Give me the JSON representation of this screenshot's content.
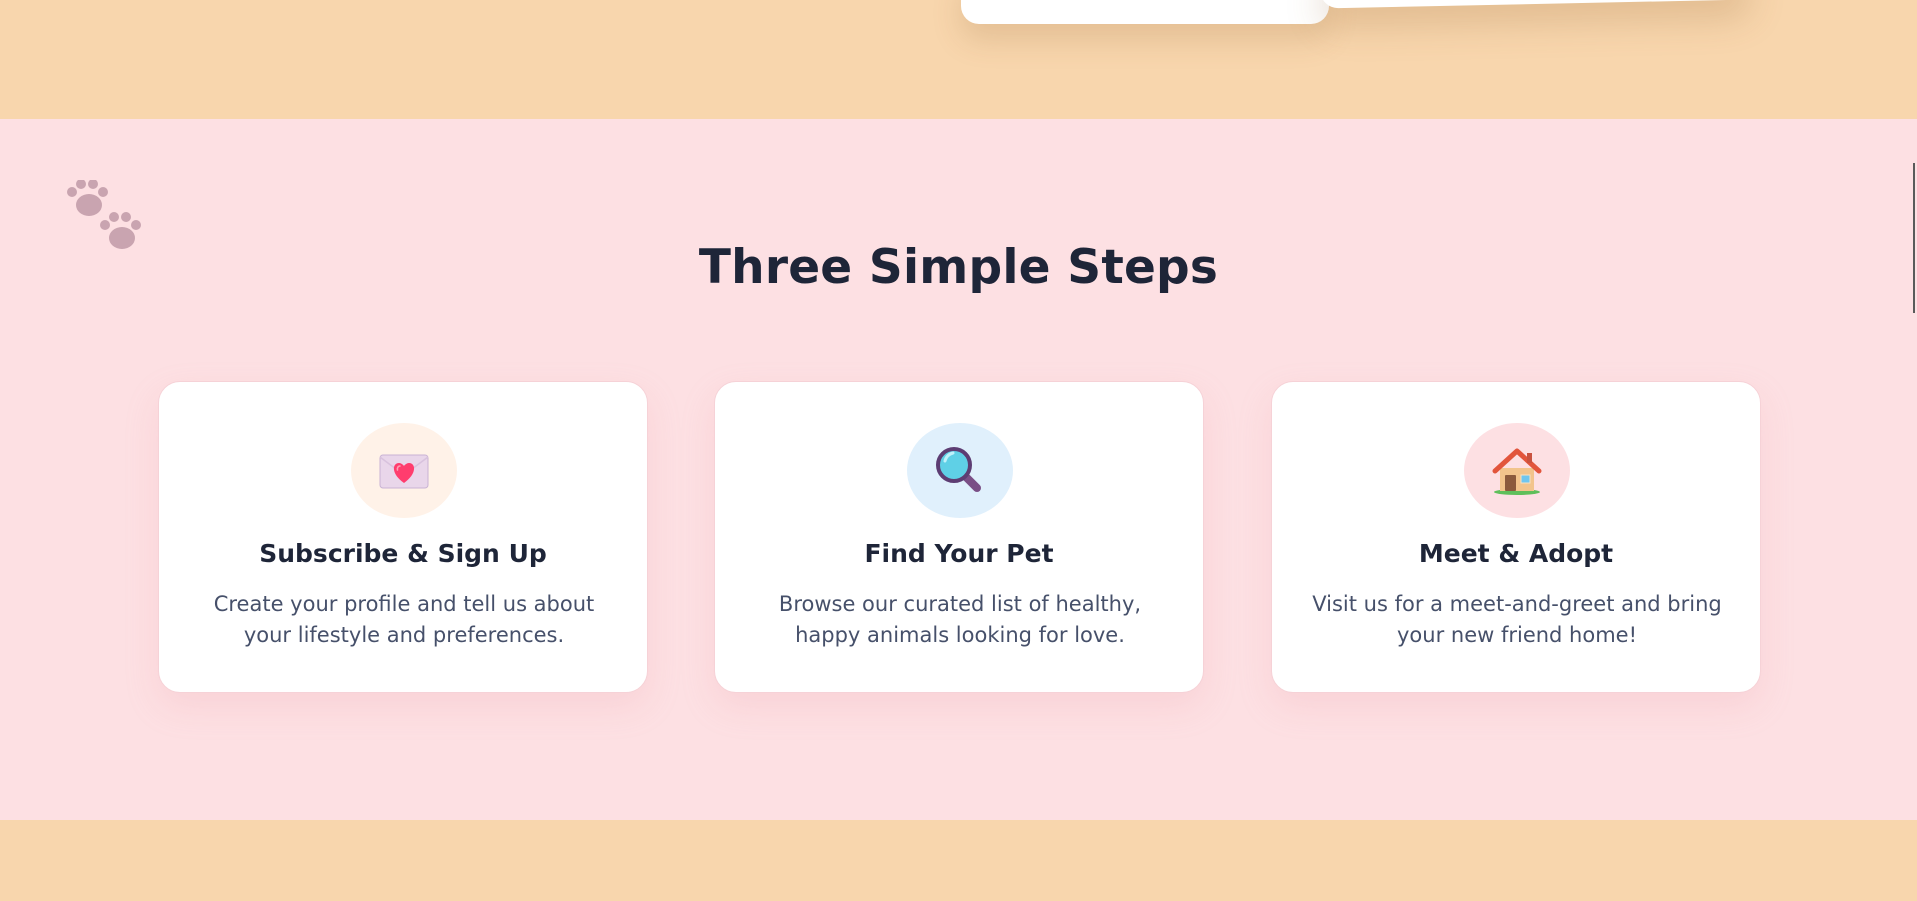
{
  "section": {
    "title": "Three Simple Steps"
  },
  "steps": [
    {
      "icon": "love-letter-icon",
      "icon_bg": "#fff2e8",
      "title": "Subscribe & Sign Up",
      "description": "Create your profile and tell us about your lifestyle and preferences."
    },
    {
      "icon": "magnifying-glass-icon",
      "icon_bg": "#e0f0fc",
      "title": "Find Your Pet",
      "description": "Browse our curated list of healthy, happy animals looking for love."
    },
    {
      "icon": "house-icon",
      "icon_bg": "#fde0e3",
      "title": "Meet & Adopt",
      "description": "Visit us for a meet-and-greet and bring your new friend home!"
    }
  ],
  "colors": {
    "peach_band": "#f8d6ad",
    "pink_section": "#fde0e3",
    "heading_text": "#1e2538",
    "body_text": "#46506a",
    "paw_decoration": "#c9a4b0"
  },
  "decorations": {
    "paw_icon": "paw-prints-icon"
  }
}
